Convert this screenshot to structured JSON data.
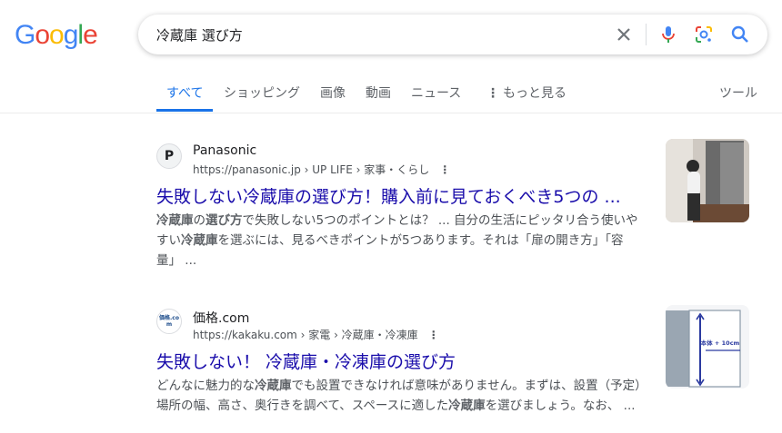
{
  "logo": {
    "letters": [
      "G",
      "o",
      "o",
      "g",
      "l",
      "e"
    ],
    "colors": [
      "#4285F4",
      "#EA4335",
      "#FBBC05",
      "#4285F4",
      "#34A853",
      "#EA4335"
    ]
  },
  "search": {
    "query": "冷蔵庫 選び方"
  },
  "tabs": [
    {
      "label": "すべて",
      "active": true
    },
    {
      "label": "ショッピング"
    },
    {
      "label": "画像"
    },
    {
      "label": "動画"
    },
    {
      "label": "ニュース"
    },
    {
      "label": "もっと見る"
    },
    {
      "label": "ツール"
    }
  ],
  "results": [
    {
      "favicon_text": "P",
      "site": "Panasonic",
      "url": "https://panasonic.jp › UP LIFE › 家事・くらし",
      "title": "失敗しない冷蔵庫の選び方！購入前に見ておくべき5つの ...",
      "snippet_parts": [
        {
          "t": "冷蔵庫",
          "b": true
        },
        {
          "t": "の",
          "b": false
        },
        {
          "t": "選び方",
          "b": true
        },
        {
          "t": "で失敗しない5つのポイントとは？ ... 自分の生活にピッタリ合う使いやすい",
          "b": false
        },
        {
          "t": "冷蔵庫",
          "b": true
        },
        {
          "t": "を選ぶには、見るべきポイントが5つあります。それは「扉の開き方」「容量」 ...",
          "b": false
        }
      ]
    },
    {
      "favicon_text": "価格.com",
      "site": "価格.com",
      "url": "https://kakaku.com › 家電 › 冷蔵庫・冷凍庫",
      "title": "失敗しない！ 冷蔵庫・冷凍庫の選び方",
      "thumb_label": "本体 + 10cm",
      "snippet_parts": [
        {
          "t": "どんなに魅力的な",
          "b": false
        },
        {
          "t": "冷蔵庫",
          "b": true
        },
        {
          "t": "でも設置できなければ意味がありません。まずは、設置（予定）場所の幅、高さ、奥行きを調べて、スペースに適した",
          "b": false
        },
        {
          "t": "冷蔵庫",
          "b": true
        },
        {
          "t": "を選びましょう。なお、 ...",
          "b": false
        }
      ]
    }
  ]
}
